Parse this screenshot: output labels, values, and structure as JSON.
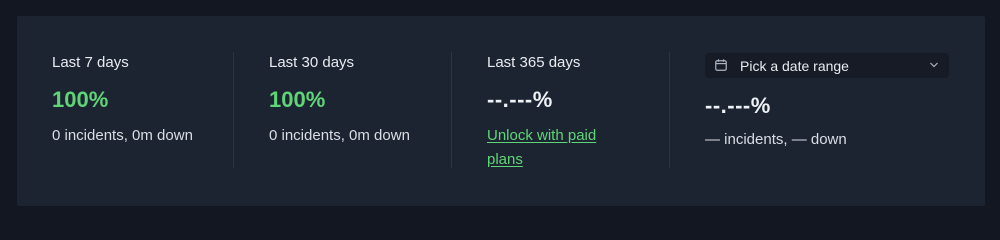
{
  "stats": [
    {
      "label": "Last 7 days",
      "value": "100%",
      "detail": "0 incidents, 0m down"
    },
    {
      "label": "Last 30 days",
      "value": "100%",
      "detail": "0 incidents, 0m down"
    },
    {
      "label": "Last 365 days",
      "value": "--.---%",
      "link": "Unlock with paid plans"
    }
  ],
  "custom_range": {
    "picker_label": "Pick a date range",
    "picker_icon": "calendar-icon",
    "chevron_icon": "chevron-down-icon",
    "value": "--.---%",
    "detail": "— incidents, — down"
  },
  "colors": {
    "background": "#121721",
    "panel": "#1d2431",
    "accent_green": "#5fd577"
  }
}
